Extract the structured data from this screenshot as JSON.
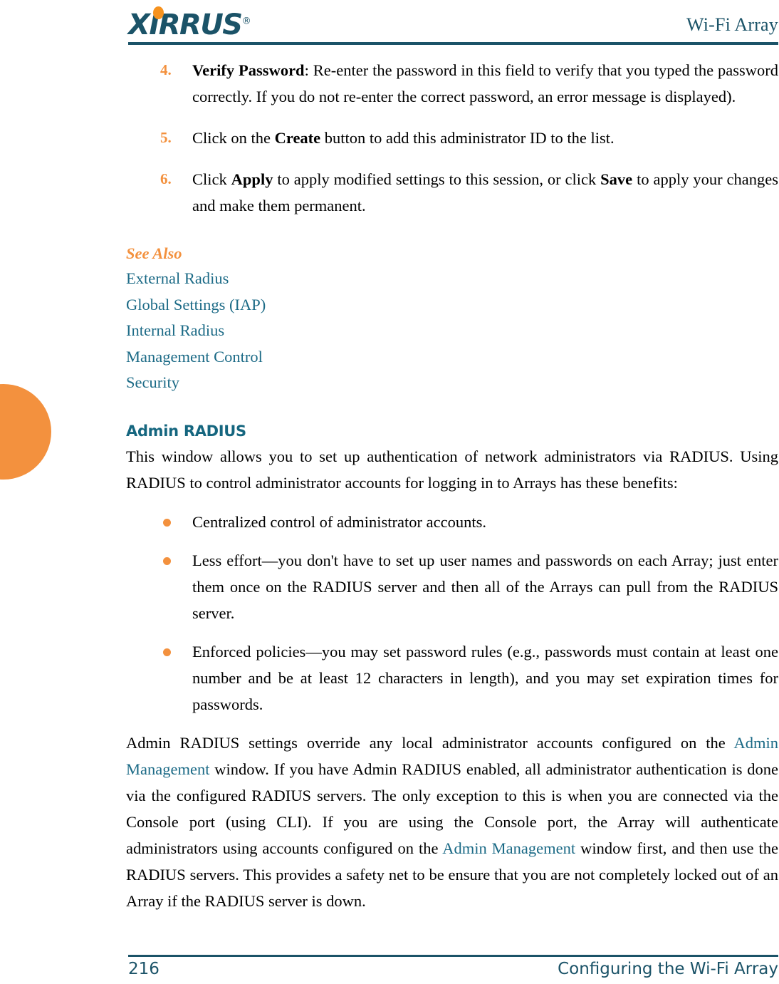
{
  "header": {
    "logo_text": "XIRRUS",
    "logo_trademark": "®",
    "title": "Wi-Fi Array"
  },
  "colors": {
    "teal": "#1b5368",
    "heading_teal": "#15667f",
    "orange": "#f3913e",
    "link_teal": "#1b6a86"
  },
  "steps": [
    {
      "number": "4.",
      "lead": "Verify Password",
      "text": ": Re-enter the password in this field to verify that you typed the password correctly. If you do not re-enter the correct password, an error message is displayed)."
    },
    {
      "number": "5.",
      "prefix": "Click on the ",
      "bold": "Create",
      "suffix": " button to add this administrator ID to the list."
    },
    {
      "number": "6.",
      "prefix": "Click ",
      "bold": "Apply",
      "mid": " to apply modified settings to this session, or click ",
      "bold2": "Save",
      "suffix": " to apply your changes and make them permanent."
    }
  ],
  "see_also": {
    "title": "See Also",
    "links": [
      "External Radius",
      "Global Settings (IAP)",
      "Internal Radius",
      "Management Control",
      "Security"
    ]
  },
  "section": {
    "heading": "Admin RADIUS",
    "intro": "This window allows you to set up authentication of network administrators via RADIUS. Using RADIUS to control administrator accounts for logging in to Arrays has these benefits:",
    "bullets": [
      "Centralized control of administrator accounts.",
      "Less effort—you don't have to set up user names and passwords on each Array; just enter them once on the RADIUS server and then all of the Arrays can pull from the RADIUS server.",
      "Enforced policies—you may set password rules (e.g., passwords must contain at least one number and be at least 12 characters in length), and you may set expiration times for passwords."
    ],
    "closing": {
      "part1": "Admin RADIUS settings override any local administrator accounts configured on the ",
      "link1": "Admin Management",
      "part2": " window. If you have Admin RADIUS enabled, all administrator authentication is done via the configured RADIUS servers. The only exception to this is when you are connected via the Console port (using CLI). If you are using the Console port, the Array will authenticate administrators using accounts configured on the ",
      "link2": "Admin Management",
      "part3": " window first, and then use the RADIUS servers. This provides a safety net to be ensure that you are not completely locked out of an Array if the RADIUS server is down."
    }
  },
  "footer": {
    "page_number": "216",
    "title": "Configuring the Wi-Fi Array"
  }
}
